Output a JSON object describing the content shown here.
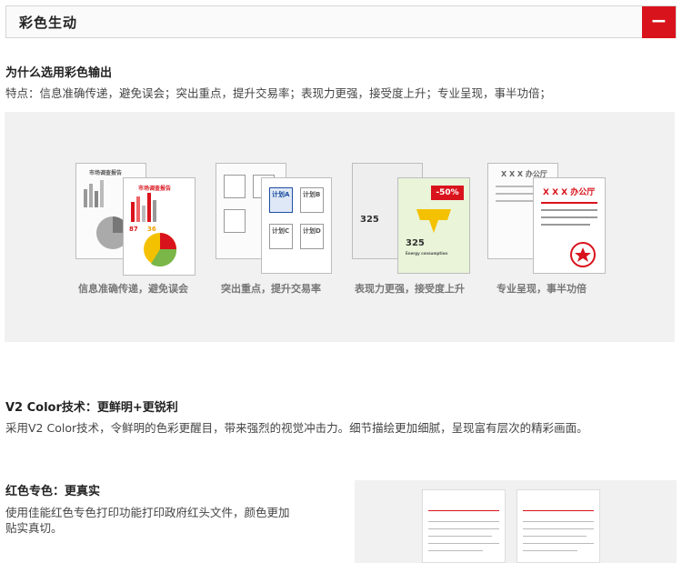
{
  "header": {
    "title": "彩色生动",
    "collapse_symbol": "−"
  },
  "section_why": {
    "heading": "为什么选用彩色输出",
    "text": "特点：信息准确传递，避免误会；突出重点，提升交易率；表现力更强，接受度上升；专业呈现，事半功倍；"
  },
  "illustrations": [
    {
      "caption": "信息准确传递，避免误会",
      "report_title": "市场调查报告",
      "values": [
        "87",
        "36"
      ]
    },
    {
      "caption": "突出重点，提升交易率",
      "plans": [
        "计划A",
        "计划B",
        "计划C",
        "计划D"
      ]
    },
    {
      "caption": "表现力更强，接受度上升",
      "discount": "-50%",
      "number": "325",
      "label": "Energy consumption"
    },
    {
      "caption": "专业呈现，事半功倍",
      "office": "X X X 办公厅"
    }
  ],
  "section_v2": {
    "heading": "V2 Color技术：更鲜明+更锐利",
    "text": "采用V2 Color技术，令鲜明的色彩更醒目，带来强烈的视觉冲击力。细节描绘更加细腻，呈现富有层次的精彩画面。"
  },
  "section_red": {
    "heading": "红色专色：更真实",
    "text_line1": "使用佳能红色专色打印功能打印政府红头文件，颜色更加",
    "text_line2": "贴实真切。"
  },
  "colors": {
    "accent_red": "#d9131c",
    "panel_gray": "#f1f1f1"
  }
}
